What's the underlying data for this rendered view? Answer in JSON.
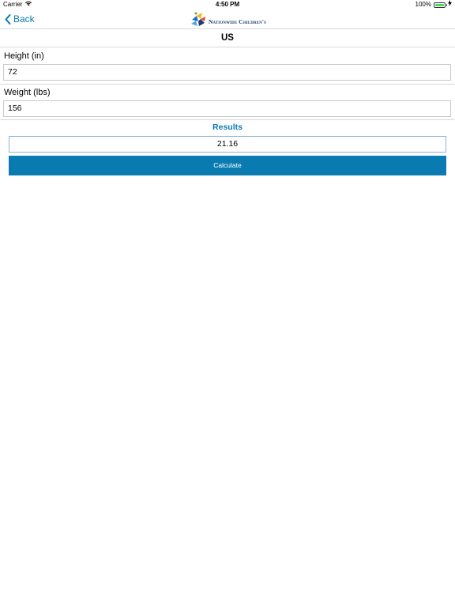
{
  "status_bar": {
    "carrier": "Carrier",
    "time": "4:50 PM",
    "battery_percent": "100%",
    "battery_level": 1.0
  },
  "nav": {
    "back_label": "Back",
    "logo_text": "Nationwide Children's"
  },
  "section_title": "US",
  "height": {
    "label": "Height (in)",
    "value": "72"
  },
  "weight": {
    "label": "Weight (lbs)",
    "value": "156"
  },
  "results": {
    "label": "Results",
    "value": "21.16"
  },
  "calculate_label": "Calculate",
  "colors": {
    "accent": "#0a7bb0",
    "logo_navy": "#1d3c6e"
  }
}
